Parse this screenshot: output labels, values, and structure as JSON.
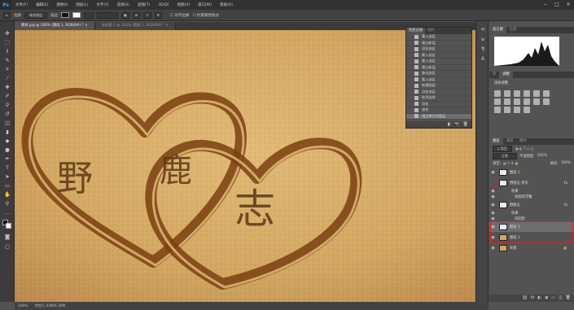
{
  "app": {
    "logo": "Ps"
  },
  "menu": [
    "文件(F)",
    "编辑(E)",
    "图像(I)",
    "图层(L)",
    "文字(Y)",
    "选择(S)",
    "滤镜(T)",
    "3D(D)",
    "视图(V)",
    "窗口(W)",
    "帮助(H)"
  ],
  "window_controls": [
    "−",
    "□",
    "✕"
  ],
  "options_bar": {
    "mode_label": "选择",
    "preset": "填充图层",
    "stroke_label": "描边",
    "align_label": "对齐边缘",
    "constrain_label": "约束路径拖动"
  },
  "tabs": [
    {
      "label": "素材.jpg @ 100% (图层 1, RGB/8#) *",
      "close": "×"
    },
    {
      "label": "未标题-1 @ 100% (图层 1, RGB/8#) *",
      "close": "×"
    }
  ],
  "status": {
    "zoom": "100%",
    "doc": "文档:1.43M/6.28M"
  },
  "artwork": {
    "chars": [
      "野",
      "鹿",
      "志"
    ]
  },
  "history_panel": {
    "tabs": [
      "历史记录",
      "动作"
    ],
    "items": [
      "载入选区",
      "建立新层",
      "羽化选区",
      "载入选区",
      "载入选区",
      "建立新层",
      "移动选区",
      "载入选区",
      "新建图层",
      "羽化选区",
      "取消选择",
      "羽化",
      "液化",
      "通过拷贝的图层"
    ],
    "footer_icons": [
      "◧",
      "📷",
      "🗑"
    ]
  },
  "histogram_panel": {
    "tabs": [
      "直方图",
      "信息"
    ]
  },
  "adjust_panel": {
    "tabs": [
      "库",
      "调整"
    ],
    "title": "添加调整"
  },
  "layers_panel": {
    "tabs": [
      "图层",
      "通道",
      "路径"
    ],
    "kind_label": "ρ 类型",
    "blend_mode": "正常",
    "opacity_label": "不透明度:",
    "opacity_value": "100%",
    "lock_label": "锁定:",
    "fill_label": "填充:",
    "fill_value": "100%",
    "fx": "fx",
    "layers": [
      {
        "name": "图层 2",
        "visible": true
      },
      {
        "name": "野鹿志 拷贝",
        "visible": true,
        "fx": true
      },
      {
        "name": "效果",
        "visible": true,
        "sub": true
      },
      {
        "name": "斜面和浮雕",
        "visible": true,
        "sub": true
      },
      {
        "name": "野鹿志",
        "visible": true,
        "fx": true
      },
      {
        "name": "效果",
        "visible": true,
        "sub": true
      },
      {
        "name": "内阴影",
        "visible": true,
        "sub": true
      },
      {
        "name": "图层 1",
        "visible": true,
        "selected": true
      },
      {
        "name": "图层 1",
        "visible": true
      },
      {
        "name": "背景",
        "visible": true,
        "locked": true
      }
    ],
    "footer_icons": [
      "⛓",
      "fx",
      "◐",
      "◑",
      "▭",
      "◫",
      "🗑"
    ]
  },
  "colors": {
    "highlight": "#e02020",
    "sand": "#d1a866",
    "accent_blue": "#31a8ff"
  }
}
